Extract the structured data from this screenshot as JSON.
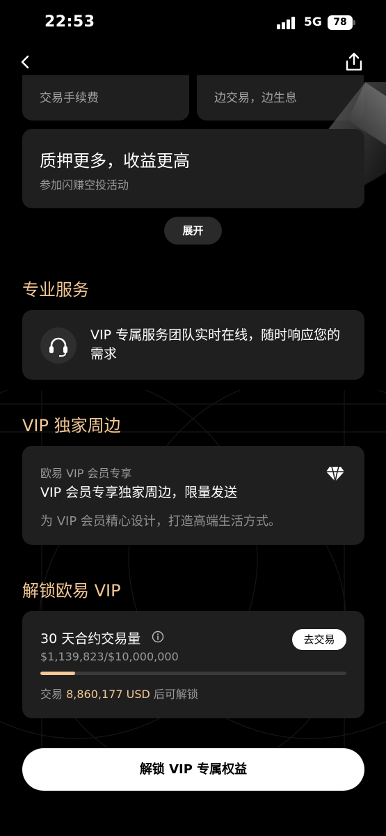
{
  "status_bar": {
    "time": "22:53",
    "network": "5G",
    "battery": "78"
  },
  "nav": {
    "back_icon": "chevron-left-icon",
    "share_icon": "share-icon"
  },
  "benefits": {
    "left_card_text": "交易手续费",
    "right_card_text": "边交易，边生息",
    "pledge_title": "质押更多，收益更高",
    "pledge_subtitle": "参加闪赚空投活动",
    "expand_label": "展开"
  },
  "pro_service": {
    "title": "专业服务",
    "icon": "headset-icon",
    "text": "VIP 专属服务团队实时在线，随时响应您的需求"
  },
  "merch": {
    "title": "VIP 独家周边",
    "label": "欧易 VIP 会员专享",
    "headline": "VIP 会员专享独家周边，限量发送",
    "description": "为 VIP 会员精心设计，打造高端生活方式。",
    "icon": "diamond-icon"
  },
  "unlock": {
    "title": "解锁欧易 VIP",
    "volume_label": "30 天合约交易量",
    "volume_value": "$1,139,823/$10,000,000",
    "progress_percent": 11.4,
    "trade_button": "去交易",
    "remain_prefix": "交易",
    "remain_amount": "8,860,177 USD",
    "remain_suffix": "后可解锁",
    "cta_label": "解锁 VIP 专属权益"
  },
  "colors": {
    "accent_gold": "#f4c896",
    "card_bg": "#1f1f1f",
    "page_bg": "#000000"
  }
}
